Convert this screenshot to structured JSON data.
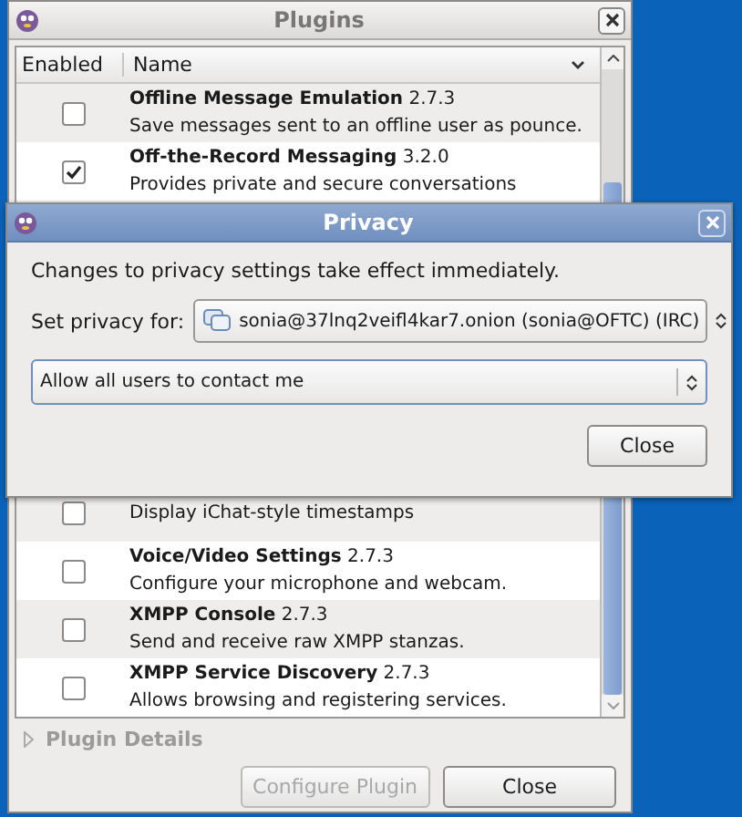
{
  "plugins_window": {
    "title": "Plugins",
    "columns": [
      "Enabled",
      "Name"
    ],
    "rows": [
      {
        "name": "**Offline Message Emulation** 2.7.3",
        "description": "Save messages sent to an offline user as pounce.",
        "enabled": false
      },
      {
        "name": "**Off-the-Record Messaging** 3.2.0",
        "description": "Provides private and secure conversations",
        "enabled": true
      },
      {
        "description": "Display iChat-style timestamps",
        "enabled": false
      },
      {
        "name": "**Voice/Video Settings** 2.7.3",
        "description": "Configure your microphone and webcam.",
        "enabled": false
      },
      {
        "name": "**XMPP Console** 2.7.3",
        "description": "Send and receive raw XMPP stanzas.",
        "enabled": false
      },
      {
        "name": "**XMPP Service Discovery** 2.7.3",
        "description": "Allows browsing and registering services.",
        "enabled": false
      }
    ],
    "details_label": "Plugin Details",
    "buttons": [
      {
        "label": "Configure Plugin",
        "disabled": true
      },
      {
        "label": "Close",
        "disabled": false
      }
    ]
  },
  "privacy_window": {
    "title": "Privacy",
    "message": "Changes to privacy settings take effect immediately.",
    "account_label": "Set privacy for:",
    "account_value": "sonia@37lnq2veifl4kar7.onion (sonia@OFTC) (IRC)",
    "policy_value": "Allow all users to contact me",
    "button": "Close"
  }
}
